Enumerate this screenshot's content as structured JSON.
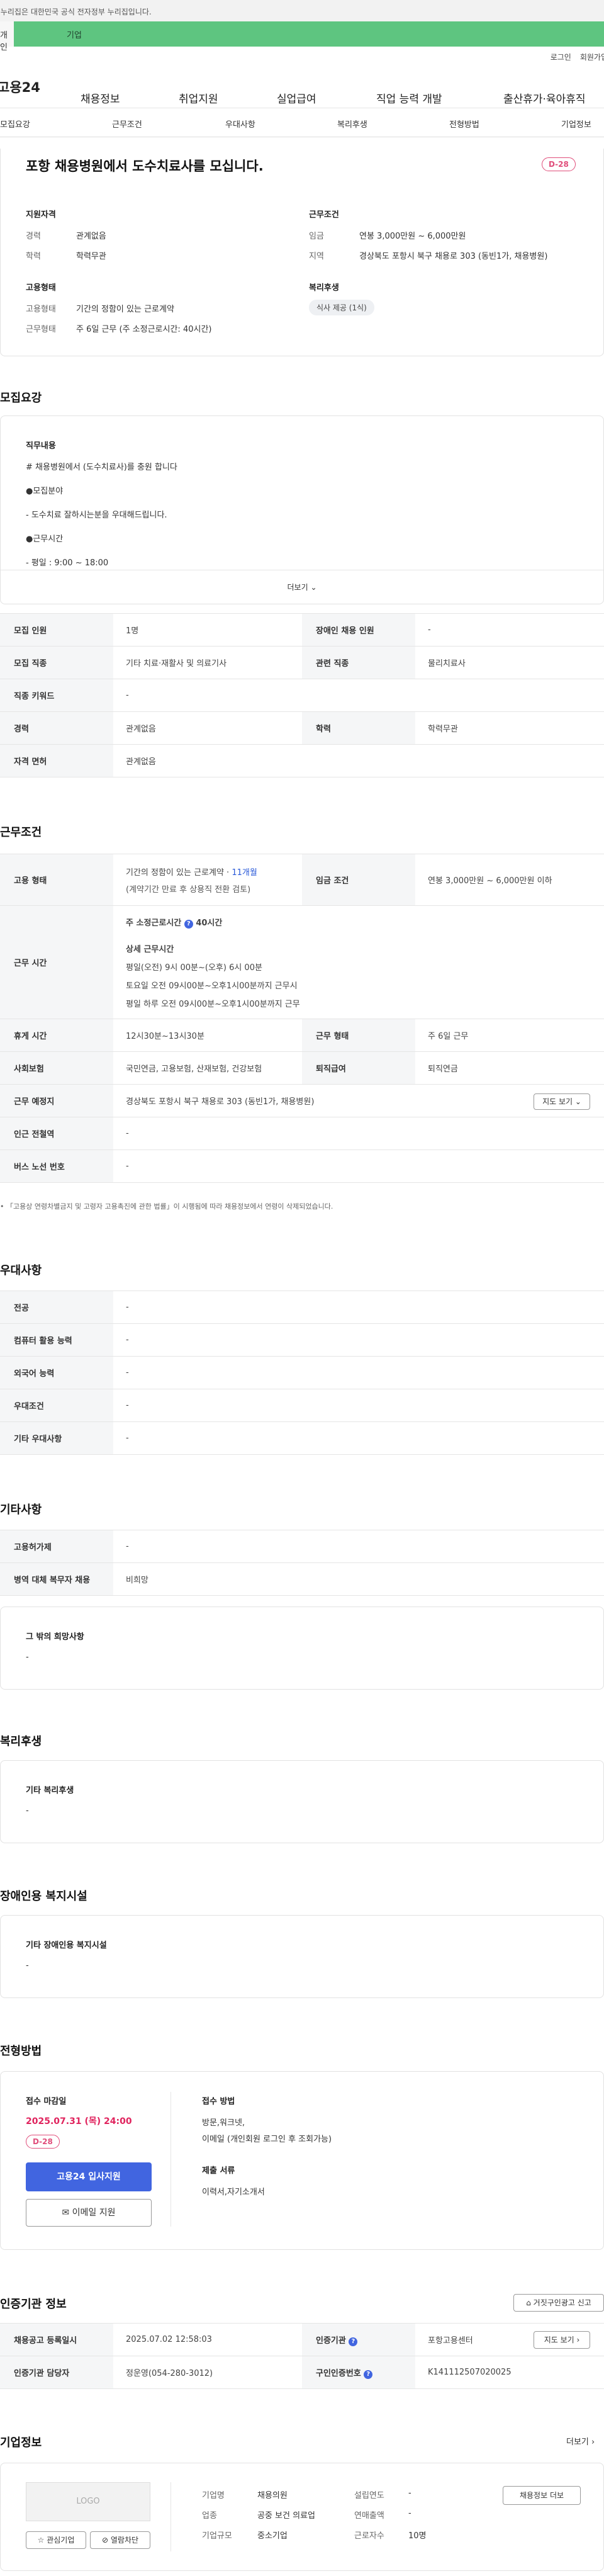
{
  "gov_banner": "이 누리집은 대한민국 공식 전자정부 누리집입니다.",
  "tabs": [
    "개인",
    "기업"
  ],
  "util": [
    "로그인",
    "회원가입"
  ],
  "logo": "고용24",
  "gnb": [
    "채용정보",
    "취업지원",
    "실업급여",
    "직업 능력 개발",
    "출산휴가·육아휴직"
  ],
  "subnav": [
    "모집요강",
    "근무조건",
    "우대사항",
    "복리후생",
    "전형방법",
    "기업정보"
  ],
  "header": {
    "title": "포항 채용병원에서 도수치료사를 모십니다.",
    "dday": "D-28",
    "qual_title": "지원자격",
    "qual": [
      {
        "k": "경력",
        "v": "관계없음"
      },
      {
        "k": "학력",
        "v": "학력무관"
      }
    ],
    "cond_title": "근무조건",
    "cond": [
      {
        "k": "임금",
        "v": "연봉 3,000만원 ~ 6,000만원"
      },
      {
        "k": "지역",
        "v": "경상북도 포항시 북구 채용로 303 (동빈1가, 채용병원)"
      }
    ],
    "emp_title": "고용형태",
    "emp": [
      {
        "k": "고용형태",
        "v": "기간의 정함이 있는 근로계약"
      },
      {
        "k": "근무형태",
        "v": "주 6일 근무 (주 소정근로시간: 40시간)"
      }
    ],
    "welfare_title": "복리후생",
    "welfare_chip": "식사 제공 (1식)"
  },
  "recruit": {
    "title": "모집요강",
    "duty_title": "직무내용",
    "duty_lines": [
      "# 채용병원에서 (도수치료사)를 충원 합니다",
      "●모집분야",
      "- 도수치료 잘하시는분을 우대해드립니다.",
      "●근무시간",
      "- 평일 : 9:00 ~ 18:00"
    ],
    "more": "더보기",
    "rows": [
      [
        "모집 인원",
        "1명",
        "장애인 채용 인원",
        "-"
      ],
      [
        "모집 직종",
        "기타 치료·재활사 및 의료기사",
        "관련 직종",
        "물리치료사"
      ],
      [
        "직종 키워드",
        "-",
        "",
        ""
      ],
      [
        "경력",
        "관계없음",
        "학력",
        "학력무관"
      ],
      [
        "자격 면허",
        "관계없음",
        "",
        ""
      ]
    ]
  },
  "work": {
    "title": "근무조건",
    "emp_label": "고용 형태",
    "emp_v1": "기간의 정함이 있는 근로계약 · ",
    "emp_v1_blue": "11개월",
    "emp_v2": "(계약기간 만료 후 상용직 전환 검토)",
    "wage_label": "임금 조건",
    "wage_v": "연봉 3,000만원 ~ 6,000만원 이하",
    "time_label": "근무 시간",
    "time_weekly": "주 소정근로시간",
    "time_weekly_v": "40시간",
    "time_detail_title": "상세 근무시간",
    "time_detail": [
      "평일(오전) 9시 00분~(오후) 6시 00분",
      "토요일 오전 09시00분~오후1시00분까지 근무시",
      "평일 하루 오전 09시00분~오후1시00분까지 근무"
    ],
    "break_label": "휴게 시간",
    "break_v": "12시30분~13시30분",
    "form_label": "근무 형태",
    "form_v": "주 6일 근무",
    "ins_label": "사회보험",
    "ins_v": "국민연금, 고용보험, 산재보험, 건강보험",
    "ret_label": "퇴직급여",
    "ret_v": "퇴직연금",
    "place_label": "근무 예정지",
    "place_v": "경상북도 포항시 북구 채용로 303 (동빈1가, 채용병원)",
    "map_btn": "지도 보기",
    "subway_label": "인근 전철역",
    "subway_v": "-",
    "bus_label": "버스 노선 번호",
    "bus_v": "-",
    "note": "「고용상 연령차별금지 및 고령자 고용촉진에 관한 법률」이 시행됨에 따라 채용정보에서 연령이 삭제되었습니다."
  },
  "pref": {
    "title": "우대사항",
    "rows": [
      [
        "전공",
        "-"
      ],
      [
        "컴퓨터 활용 능력",
        "-"
      ],
      [
        "외국어 능력",
        "-"
      ],
      [
        "우대조건",
        "-"
      ],
      [
        "기타 우대사항",
        "-"
      ]
    ]
  },
  "etc": {
    "title": "기타사항",
    "rows": [
      [
        "고용허가제",
        "-"
      ],
      [
        "병역 대체 복무자 채용",
        "비희망"
      ]
    ],
    "other_title": "그 밖의 희망사항",
    "other_v": "-"
  },
  "welfare": {
    "title": "복리후생",
    "sub": "기타 복리후생",
    "v": "-"
  },
  "disabled": {
    "title": "장애인용 복지시설",
    "sub": "기타 장애인용 복지시설",
    "v": "-"
  },
  "selection": {
    "title": "전형방법",
    "deadline_label": "접수 마감일",
    "deadline": "2025.07.31 (목) 24:00",
    "dday": "D-28",
    "apply_btn": "고용24 입사지원",
    "email_btn": "이메일 지원",
    "method_label": "접수 방법",
    "method_v1": "방문,워크넷,",
    "method_v2": "이메일 (개인회원 로그인 후 조회가능)",
    "docs_label": "제출 서류",
    "docs_v": "이력서,자기소개서"
  },
  "agency": {
    "title": "인증기관 정보",
    "report_btn": "거짓구인광고 신고",
    "reg_label": "채용공고 등록일시",
    "reg_v": "2025.07.02 12:58:03",
    "agency_label": "인증기관",
    "agency_v": "포항고용센터",
    "map_btn": "지도 보기",
    "manager_label": "인증기관 담당자",
    "manager_v": "정운영(054-280-3012)",
    "auth_label": "구인인증번호",
    "auth_v": "K141112507020025"
  },
  "company": {
    "title": "기업정보",
    "more": "더보기",
    "logo": "LOGO",
    "like_btn": "관심기업",
    "block_btn": "열람차단",
    "info_btn": "채용정보 더보",
    "rows": [
      [
        "기업명",
        "채용의원",
        "설립연도",
        "-"
      ],
      [
        "업종",
        "공중 보건 의료업",
        "연매출액",
        "-"
      ],
      [
        "기업규모",
        "중소기업",
        "근로자수",
        "10명"
      ]
    ]
  }
}
